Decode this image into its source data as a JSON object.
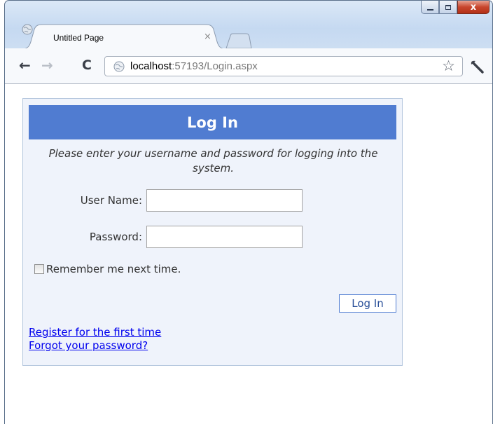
{
  "window": {
    "caption_buttons": [
      "minimize-icon",
      "maximize-icon",
      "close-icon"
    ],
    "close_glyph": "x"
  },
  "browser": {
    "tab": {
      "title": "Untitled Page",
      "close_glyph": "×",
      "icon": "page-globe-icon"
    },
    "new_tab_icon": "new-tab-icon",
    "nav": {
      "back_glyph": "←",
      "forward_glyph": "→",
      "reload_glyph": "C"
    },
    "address": {
      "host": "localhost",
      "rest": ":57193/Login.aspx"
    },
    "bookmark_glyph": "☆",
    "menu_icon": "wrench-icon"
  },
  "login": {
    "title": "Log In",
    "instructions": "Please enter your username and password for logging into the system.",
    "username_label": "User Name:",
    "username_value": "",
    "password_label": "Password:",
    "password_value": "",
    "remember_label": "Remember me next time.",
    "remember_checked": false,
    "button_label": "Log In",
    "register_link": "Register for the first time",
    "forgot_link": "Forgot your password?"
  },
  "colors": {
    "header_bg": "#507cd1",
    "panel_bg": "#eff3fb",
    "link": "#0000ee",
    "button_text": "#284e98"
  }
}
